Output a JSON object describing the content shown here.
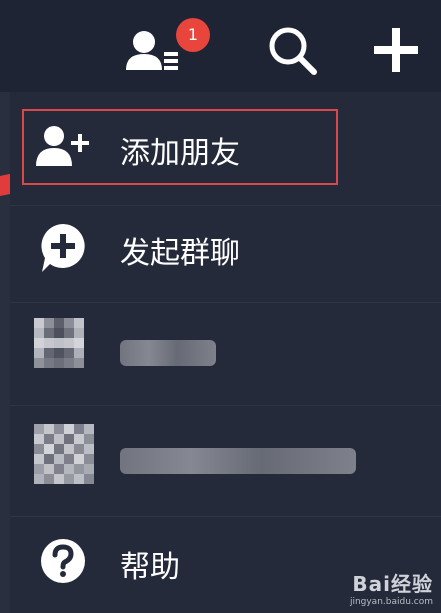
{
  "header": {
    "contacts_badge_count": "1"
  },
  "menu": {
    "items": [
      {
        "label": "添加朋友",
        "icon": "add-friend-icon"
      },
      {
        "label": "发起群聊",
        "icon": "group-chat-icon"
      },
      {
        "label": "",
        "icon": "blurred-avatar"
      },
      {
        "label": "",
        "icon": "blurred-avatar"
      },
      {
        "label": "帮助",
        "icon": "help-icon"
      }
    ]
  },
  "watermark": {
    "logo": "Bai经验",
    "url": "jingyan.baidu.com"
  },
  "colors": {
    "background": "#1d2232",
    "menu_bg": "#252a3a",
    "badge": "#e8453c",
    "highlight": "#d9484b",
    "arrow": "#e03c3c"
  }
}
